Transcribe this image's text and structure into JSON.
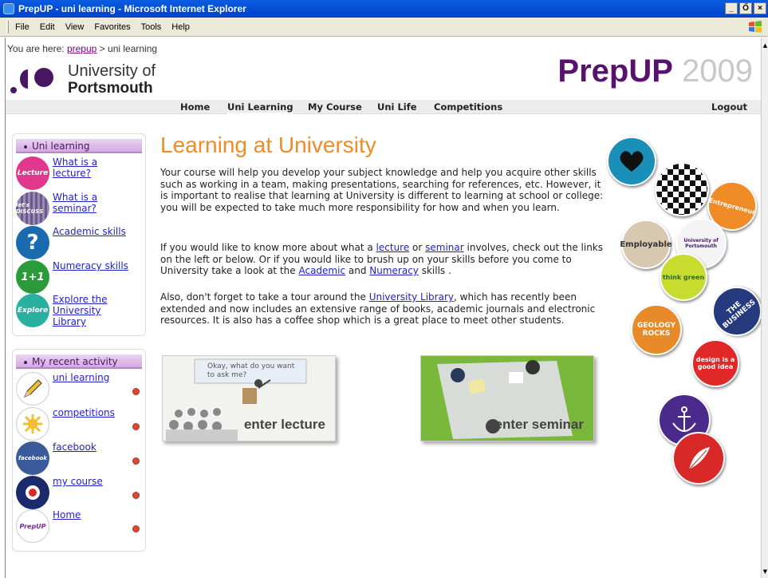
{
  "window": {
    "title": "PrepUP - uni learning - Microsoft Internet Explorer",
    "buttons": [
      "_",
      "Ő",
      "×"
    ]
  },
  "menubar": {
    "items": [
      "File",
      "Edit",
      "View",
      "Favorites",
      "Tools",
      "Help"
    ]
  },
  "breadcrumb": {
    "prefix": "You are here: ",
    "link": "prepup",
    "sep": " > ",
    "current": "uni learning"
  },
  "logo": {
    "line1": "University of",
    "line2": "Portsmouth"
  },
  "brand": {
    "name": "PrepUP",
    "year": "2009"
  },
  "nav": {
    "items": [
      "Home",
      "Uni Learning",
      "My Course",
      "Uni Life",
      "Competitions"
    ],
    "logout": "Logout"
  },
  "sidebar": {
    "uni_learning": {
      "heading": "Uni learning",
      "items": [
        {
          "label": "What is a lecture?",
          "icon": "lecture-icon",
          "icon_text": "Lecture",
          "color": "#e0388c"
        },
        {
          "label": "What is a seminar?",
          "icon": "seminar-icon",
          "icon_text": "let's DISCUSS",
          "color": "#6a5a8a"
        },
        {
          "label": "Academic skills",
          "icon": "question-icon",
          "icon_text": "?",
          "color": "#1a6ab0"
        },
        {
          "label": "Numeracy skills",
          "icon": "numeracy-icon",
          "icon_text": "1+1",
          "color": "#2a9a3a"
        },
        {
          "label": "Explore the University Library",
          "icon": "explore-icon",
          "icon_text": "Explore",
          "color": "#2ab0a0"
        }
      ]
    },
    "recent_activity": {
      "heading": "My recent activity",
      "items": [
        {
          "label": "uni learning",
          "icon": "pencil-icon"
        },
        {
          "label": "competitions",
          "icon": "star-icon"
        },
        {
          "label": "facebook",
          "icon": "facebook-icon",
          "icon_text": "facebook"
        },
        {
          "label": "my course",
          "icon": "target-icon"
        },
        {
          "label": "Home",
          "icon": "prepup-icon",
          "icon_text": "PrepUP"
        }
      ]
    }
  },
  "main": {
    "title": "Learning at University",
    "p1": "Your course will help you develop your subject knowledge and help you acquire other skills such as working in a team, making presentations, searching for references, etc. However, it is important to realise that learning at University is different to learning at school or college: you will be expected to take much more responsibility for how and when you learn.",
    "p2_a": "If you would like to know more about what a ",
    "p2_link1": "lecture",
    "p2_b": " or ",
    "p2_link2": "seminar",
    "p2_c": " involves, check out the links on the left or below. Or if you would like to brush up on your skills before you come to University take a look at the ",
    "p2_link3": "Academic",
    "p2_d": " and ",
    "p2_link4": "Numeracy",
    "p2_e": " skills .",
    "p3_a": "Also, don't forget to take a tour around the ",
    "p3_link": "University Library",
    "p3_b": ", which has recently been extended and now includes an extensive range of books, academic journals and electronic resources. It is also has a coffee shop which is a great place to meet other students.",
    "lecture_card": {
      "label": "enter lecture",
      "speech": "Okay, what do you want to ask me?"
    },
    "seminar_card": {
      "label": "enter seminar"
    }
  },
  "badges": [
    {
      "name": "heart-badge",
      "text": "",
      "color": "#1a8fb8"
    },
    {
      "name": "checker-badge",
      "text": "",
      "color": "#ffffff"
    },
    {
      "name": "entrepreneur-badge",
      "text": "Entrepreneur",
      "color": "#f08c28"
    },
    {
      "name": "employable-badge",
      "text": "Employable",
      "color": "#d8c8b0"
    },
    {
      "name": "uop-badge",
      "text": "University of Portsmouth",
      "color": "#f4f4f4"
    },
    {
      "name": "think-green-badge",
      "text": "think green",
      "color": "#c8dc30"
    },
    {
      "name": "geology-badge",
      "text": "GEOLOGY ROCKS",
      "color": "#e88a2a"
    },
    {
      "name": "the-business-badge",
      "text": "THE BUSINESS",
      "color": "#263a80"
    },
    {
      "name": "design-badge",
      "text": "design is a good idea",
      "color": "#e02828"
    },
    {
      "name": "anchor-badge",
      "text": "",
      "color": "#4a2a8a"
    },
    {
      "name": "feather-badge",
      "text": "",
      "color": "#d82828"
    }
  ]
}
